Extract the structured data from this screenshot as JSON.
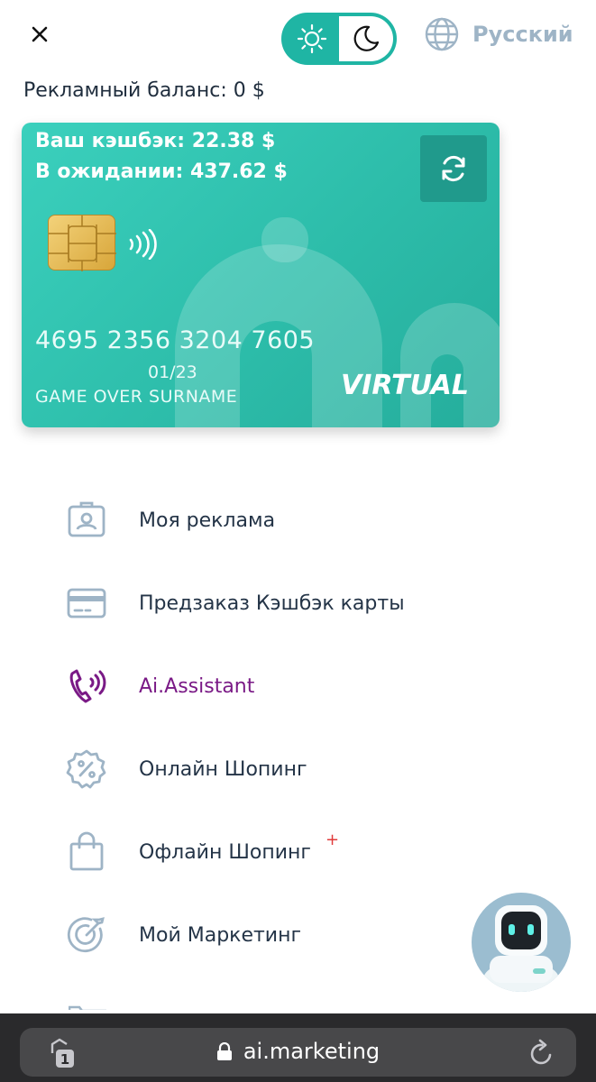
{
  "header": {
    "close_icon": "close-icon",
    "theme": {
      "light_icon": "sun-icon",
      "dark_icon": "moon-icon",
      "selected": "dark"
    },
    "language": {
      "icon": "globe-icon",
      "label": "Русский"
    }
  },
  "balance": {
    "text": "Рекламный баланс: 0 $"
  },
  "card": {
    "cashback": "Ваш кэшбэк: 22.38 $",
    "pending": "В ожидании: 437.62 $",
    "refresh_icon": "refresh-icon",
    "number": "4695 2356 3204 7605",
    "expiry": "01/23",
    "holder": "GAME OVER SURNAME",
    "brand": "VIRTUAL",
    "colors": {
      "start": "#3bd0bd",
      "end": "#25ad9c"
    }
  },
  "menu": {
    "items": [
      {
        "label": "Моя реклама",
        "icon": "id-badge-icon"
      },
      {
        "label": "Предзаказ Кэшбэк карты",
        "icon": "credit-card-icon"
      },
      {
        "label": "Ai.Assistant",
        "icon": "phone-call-icon",
        "accent": "#7a1a86"
      },
      {
        "label": "Онлайн Шопинг",
        "icon": "percent-badge-icon"
      },
      {
        "label": "Офлайн Шопинг",
        "icon": "shopping-bag-icon",
        "badge": "+"
      },
      {
        "label": "Мой Маркетинг",
        "icon": "target-icon"
      }
    ]
  },
  "assistant_fab": {
    "icon": "robot-icon"
  },
  "browser": {
    "url": "ai.marketing",
    "tabs_count": "1",
    "lock_icon": "lock-icon",
    "reload_icon": "reload-icon"
  },
  "colors": {
    "accent": "#1fb5a4",
    "muted": "#9eb4c6",
    "text": "#243447",
    "assistant": "#7a1a86",
    "badge": "#e03a3a"
  }
}
